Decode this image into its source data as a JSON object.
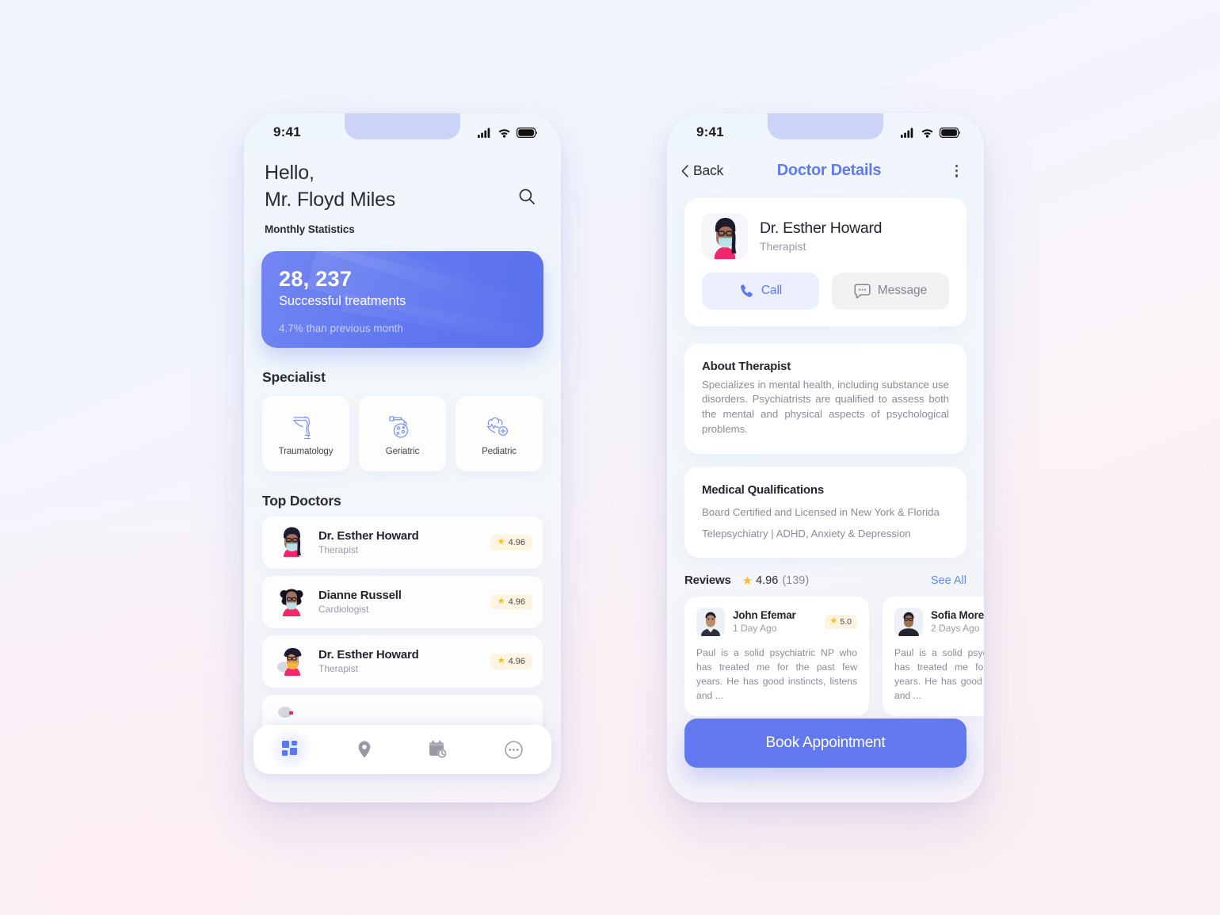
{
  "home": {
    "status": {
      "time": "9:41",
      "signal_icon": "signal-bars-icon",
      "wifi_icon": "wifi-icon",
      "battery_icon": "battery-icon"
    },
    "greeting_line1": "Hello,",
    "greeting_line2": "Mr. Floyd Miles",
    "section_label": "Monthly Statistics",
    "search_icon": "search-icon",
    "stat": {
      "number": "28, 237",
      "description": "Successful treatments",
      "note": "4.7% than previous month"
    },
    "specialist_title": "Specialist",
    "specialists": [
      {
        "label": "Traumatology",
        "icon": "knee-leg-icon"
      },
      {
        "label": "Geriatric",
        "icon": "dropper-petri-dish-icon"
      },
      {
        "label": "Pediatric",
        "icon": "heart-plus-icon"
      }
    ],
    "top_doctors_title": "Top Doctors",
    "doctors": [
      {
        "name": "Dr. Esther Howard",
        "role": "Therapist",
        "rating": "4.96",
        "avatar": "female-doctor-glasses-mask-avatar"
      },
      {
        "name": "Dianne Russell",
        "role": "Cardiologist",
        "rating": "4.96",
        "avatar": "female-doctor-afro-mask-avatar"
      },
      {
        "name": "Dr. Esther Howard",
        "role": "Therapist",
        "rating": "4.96",
        "avatar": "doctor-cap-orange-mask-avatar"
      }
    ],
    "nav": [
      {
        "name": "dashboard",
        "icon": "grid-icon",
        "active": true
      },
      {
        "name": "location",
        "icon": "map-pin-icon",
        "active": false
      },
      {
        "name": "schedule",
        "icon": "calendar-clock-icon",
        "active": false
      },
      {
        "name": "more",
        "icon": "more-circle-icon",
        "active": false
      }
    ]
  },
  "details": {
    "status": {
      "time": "9:41"
    },
    "back_label": "Back",
    "title": "Doctor Details",
    "menu_icon": "kebab-menu-icon",
    "profile": {
      "name": "Dr. Esther Howard",
      "role": "Therapist",
      "avatar": "female-doctor-glasses-mask-avatar",
      "call_label": "Call",
      "call_icon": "phone-icon",
      "message_label": "Message",
      "message_icon": "chat-bubble-icon"
    },
    "about": {
      "title": "About Therapist",
      "text": "Specializes in mental health, including substance use disorders. Psychiatrists are qualified to assess both the mental and physical aspects of psychological problems."
    },
    "qualifications": {
      "title": "Medical Qualifications",
      "line1": "Board Certified and Licensed in New York & Florida",
      "line2": "Telepsychiatry | ADHD, Anxiety & Depression"
    },
    "reviews": {
      "label": "Reviews",
      "score": "4.96",
      "count": "(139)",
      "see_all": "See All",
      "items": [
        {
          "name": "John Efemar",
          "time": "1 Day Ago",
          "rating": "5.0",
          "text": "Paul is a solid psychiatric NP who has treated me for the past few years. He has good instincts, listens and ...",
          "avatar": "man-suit-avatar"
        },
        {
          "name": "Sofia Moreno",
          "time": "2 Days Ago",
          "rating": "",
          "text": "Paul is a solid psychiatric NP who has treated me for the past few years. He has good instincts, listens and ...",
          "avatar": "man-glasses-avatar"
        }
      ]
    },
    "book_label": "Book Appointment"
  },
  "colors": {
    "accent": "#6178ef",
    "link": "#5f8cf4",
    "star": "#fbbc1e",
    "badge_bg": "#fdf4e1"
  }
}
